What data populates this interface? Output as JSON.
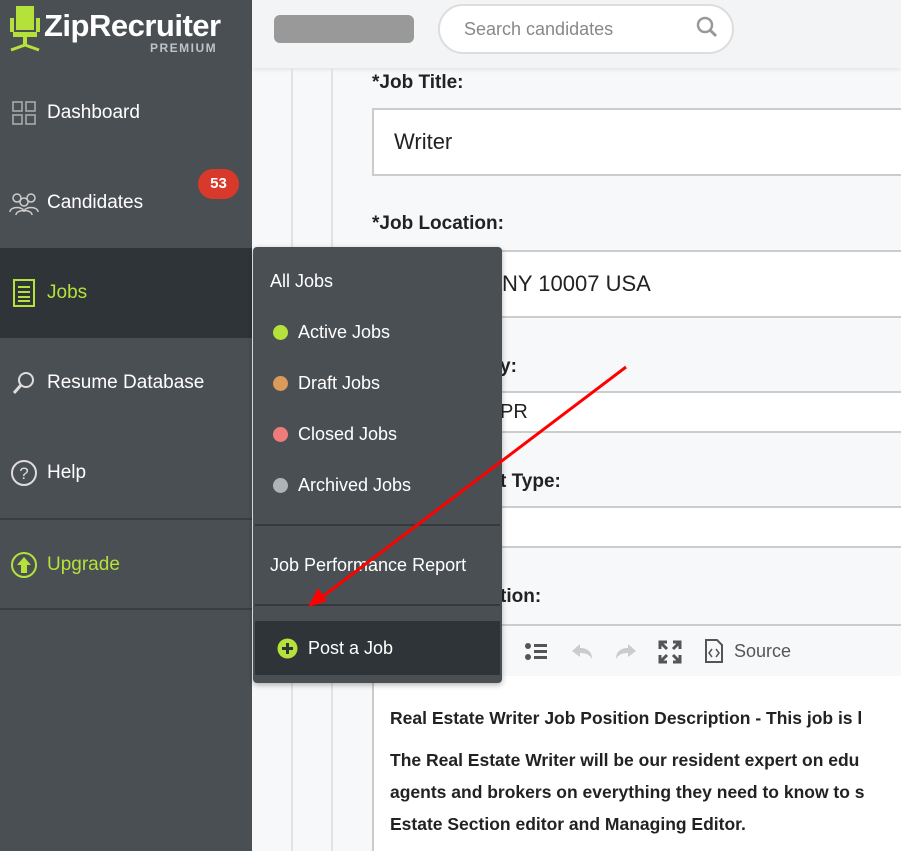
{
  "brand": {
    "name": "ZipRecruiter",
    "tier": "PREMIUM",
    "accent": "#b5e23a"
  },
  "sidebar": {
    "items": [
      {
        "label": "Dashboard",
        "icon": "grid-icon"
      },
      {
        "label": "Candidates",
        "icon": "people-icon",
        "badge": "53"
      },
      {
        "label": "Jobs",
        "icon": "document-icon",
        "active": true
      },
      {
        "label": "Resume Database",
        "icon": "search-icon"
      },
      {
        "label": "Help",
        "icon": "question-icon"
      },
      {
        "label": "Upgrade",
        "icon": "upgrade-arrow-icon"
      }
    ]
  },
  "topbar": {
    "search_placeholder": "Search candidates"
  },
  "form": {
    "job_title_label": "*Job Title:",
    "job_title_value": "Writer",
    "job_location_label": "*Job Location:",
    "job_location_value": "NY  10007 USA",
    "company_label_partial": "y:",
    "company_value_partial": "PR",
    "employment_type_label_partial": "t Type:",
    "description_label_partial": "tion:",
    "toolbar": {
      "source_label": "Source"
    },
    "description_lines": [
      "Real Estate Writer Job Position Description - This job is l",
      "The Real Estate Writer will be our resident expert on edu",
      "agents and brokers on everything they need to know to s",
      "Estate Section editor and Managing Editor."
    ]
  },
  "jobs_menu": {
    "header": "All Jobs",
    "items": [
      {
        "label": "Active Jobs",
        "color": "#b5e23a"
      },
      {
        "label": "Draft Jobs",
        "color": "#d99a5b"
      },
      {
        "label": "Closed Jobs",
        "color": "#f07b7b"
      },
      {
        "label": "Archived Jobs",
        "color": "#b0b3b6"
      }
    ],
    "report": "Job Performance Report",
    "post": "Post a Job"
  },
  "annotation": {
    "color": "#ff0000"
  }
}
